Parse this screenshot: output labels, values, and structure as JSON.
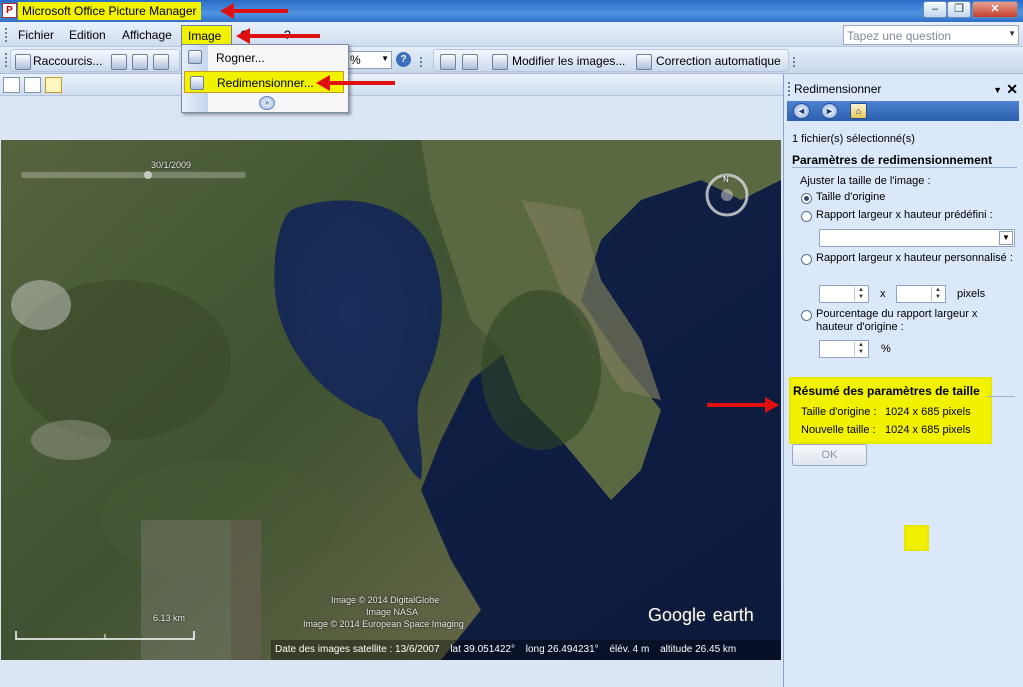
{
  "app": {
    "title": "Microsoft Office Picture Manager",
    "icon": "picture-manager-icon"
  },
  "window_controls": {
    "minimize": "‒",
    "maximize": "❐",
    "close": "✕"
  },
  "menubar": {
    "items": [
      "Fichier",
      "Edition",
      "Affichage",
      "Image",
      "O",
      "?"
    ],
    "help_placeholder": "Tapez une question"
  },
  "toolbar": {
    "shortcuts_label": "Raccourcis...",
    "zoom_value": "%",
    "help_symbol": "?",
    "edit_images_label": "Modifier les images...",
    "auto_correct_label": "Correction automatique"
  },
  "image_menu": {
    "crop_label": "Rogner...",
    "resize_label": "Redimensionner...",
    "expand_symbol": "»"
  },
  "photo": {
    "time_slider_date": "30/1/2009",
    "scale_label": "6.13 km",
    "credits": [
      "Image © 2014 DigitalGlobe",
      "Image NASA",
      "Image © 2014 European Space Imaging"
    ],
    "brand_google": "Google",
    "brand_earth": "earth",
    "compass_label": "N",
    "status": {
      "date_label": "Date des images satellite : 13/6/2007",
      "lat": "lat   39.051422°",
      "long": "long   26.494231°",
      "elev": "élév.     4 m",
      "alt": "altitude   26.45 km"
    }
  },
  "taskpane": {
    "title": "Redimensionner",
    "nav": {
      "back": "◄",
      "forward": "►",
      "home": "⌂"
    },
    "files_selected": "1 fichier(s) sélectionné(s)",
    "section_resize": "Paramètres de redimensionnement",
    "adjust_label": "Ajuster la taille de l'image :",
    "option_original": "Taille d'origine",
    "option_predefined": "Rapport largeur x hauteur prédéfini :",
    "option_custom": "Rapport largeur x hauteur personnalisé :",
    "x_label": "x",
    "pixels_label": "pixels",
    "option_percent_line1": "Pourcentage du rapport largeur x",
    "option_percent_line2": "hauteur d'origine :",
    "percent_label": "%",
    "section_summary": "Résumé des paramètres de taille",
    "original_size_label": "Taille d'origine :",
    "original_size_value": "1024 x 685 pixels",
    "new_size_label": "Nouvelle taille :",
    "new_size_value": "1024 x 685 pixels",
    "ok_label": "OK"
  },
  "colors": {
    "highlight": "#f2f200",
    "annotation_arrow": "#e01010",
    "titlebar": "#2a6cc8"
  }
}
